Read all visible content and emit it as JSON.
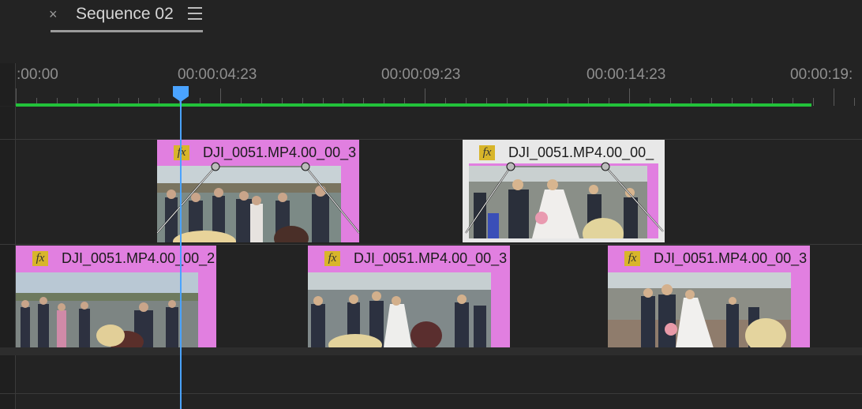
{
  "tab": {
    "title": "Sequence 02",
    "close": "×"
  },
  "ruler": {
    "timecodes": [
      ":00:00",
      "00:00:04:23",
      "00:00:09:23",
      "00:00:14:23",
      "00:00:19:"
    ]
  },
  "clips": {
    "v2a": {
      "name": "DJI_0051.MP4.00_00_3",
      "fx": "fx"
    },
    "v2b": {
      "name": "DJI_0051.MP4.00_00_",
      "fx": "fx"
    },
    "v1a": {
      "name": "DJI_0051.MP4.00_00_2",
      "fx": "fx"
    },
    "v1b": {
      "name": "DJI_0051.MP4.00_00_3",
      "fx": "fx"
    },
    "v1c": {
      "name": "DJI_0051.MP4.00_00_3",
      "fx": "fx"
    }
  },
  "colors": {
    "clip": "#e17fe0",
    "work_area": "#22c23a",
    "playhead": "#4aa3ff"
  }
}
